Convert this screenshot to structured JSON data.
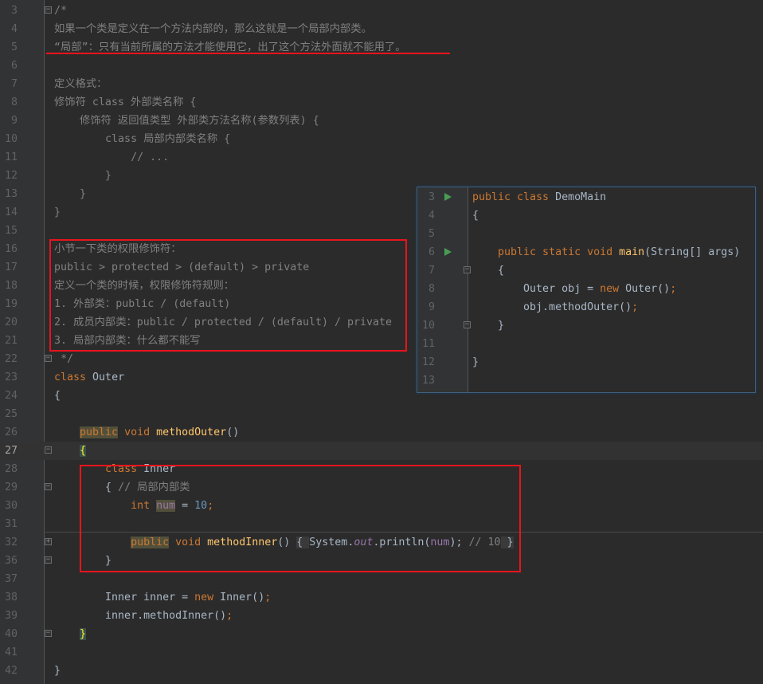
{
  "editor": {
    "lines": [
      {
        "n": "3",
        "fold": "fold-open",
        "tokens": [
          {
            "t": "/*",
            "c": "cm"
          }
        ]
      },
      {
        "n": "4",
        "tokens": [
          {
            "t": "如果一个类是定义在一个方法内部的，那么这就是一个局部内部类。",
            "c": "cm"
          }
        ]
      },
      {
        "n": "5",
        "tokens": [
          {
            "t": "“局部”：只有当前所属的方法才能使用它，出了这个方法外面就不能用了。",
            "c": "cm"
          }
        ]
      },
      {
        "n": "6",
        "tokens": []
      },
      {
        "n": "7",
        "tokens": [
          {
            "t": "定义格式：",
            "c": "cm"
          }
        ]
      },
      {
        "n": "8",
        "tokens": [
          {
            "t": "修饰符 class 外部类名称 {",
            "c": "cm"
          }
        ]
      },
      {
        "n": "9",
        "tokens": [
          {
            "t": "    修饰符 返回值类型 外部类方法名称(参数列表) {",
            "c": "cm"
          }
        ]
      },
      {
        "n": "10",
        "tokens": [
          {
            "t": "        class 局部内部类名称 {",
            "c": "cm"
          }
        ]
      },
      {
        "n": "11",
        "tokens": [
          {
            "t": "            // ...",
            "c": "cm"
          }
        ]
      },
      {
        "n": "12",
        "tokens": [
          {
            "t": "        }",
            "c": "cm"
          }
        ]
      },
      {
        "n": "13",
        "tokens": [
          {
            "t": "    }",
            "c": "cm"
          }
        ]
      },
      {
        "n": "14",
        "tokens": [
          {
            "t": "}",
            "c": "cm"
          }
        ]
      },
      {
        "n": "15",
        "tokens": []
      },
      {
        "n": "16",
        "tokens": [
          {
            "t": "小节一下类的权限修饰符：",
            "c": "cm"
          }
        ]
      },
      {
        "n": "17",
        "tokens": [
          {
            "t": "public > protected > (default) > private",
            "c": "cm"
          }
        ]
      },
      {
        "n": "18",
        "tokens": [
          {
            "t": "定义一个类的时候，权限修饰符规则：",
            "c": "cm"
          }
        ]
      },
      {
        "n": "19",
        "tokens": [
          {
            "t": "1. 外部类：public / (default)",
            "c": "cm"
          }
        ]
      },
      {
        "n": "20",
        "tokens": [
          {
            "t": "2. 成员内部类：public / protected / (default) / private",
            "c": "cm"
          }
        ]
      },
      {
        "n": "21",
        "tokens": [
          {
            "t": "3. 局部内部类：什么都不能写",
            "c": "cm"
          }
        ]
      },
      {
        "n": "22",
        "fold": "fold-close",
        "tokens": [
          {
            "t": " */",
            "c": "cm"
          }
        ]
      },
      {
        "n": "23",
        "tokens": [
          {
            "t": "class ",
            "c": "kw"
          },
          {
            "t": "Outer",
            "c": "id"
          }
        ]
      },
      {
        "n": "24",
        "tokens": [
          {
            "t": "{",
            "c": "id"
          }
        ]
      },
      {
        "n": "25",
        "tokens": []
      },
      {
        "n": "26",
        "tokens": [
          {
            "t": "    ",
            "c": "id"
          },
          {
            "t": "public",
            "c": "kw hl"
          },
          {
            "t": " void ",
            "c": "kw"
          },
          {
            "t": "methodOuter",
            "c": "fn"
          },
          {
            "t": "()",
            "c": "id"
          }
        ]
      },
      {
        "n": "27",
        "current": true,
        "fold": "fold-open",
        "tokens": [
          {
            "t": "    ",
            "c": "id"
          },
          {
            "t": "{",
            "c": "br"
          }
        ]
      },
      {
        "n": "28",
        "tokens": [
          {
            "t": "        ",
            "c": "id"
          },
          {
            "t": "class ",
            "c": "kw"
          },
          {
            "t": "Inner",
            "c": "id"
          }
        ]
      },
      {
        "n": "29",
        "fold": "fold-open",
        "tokens": [
          {
            "t": "        { ",
            "c": "id"
          },
          {
            "t": "// 局部内部类",
            "c": "cm"
          }
        ]
      },
      {
        "n": "30",
        "tokens": [
          {
            "t": "            ",
            "c": "id"
          },
          {
            "t": "int ",
            "c": "kw"
          },
          {
            "t": "num",
            "c": "fld hl"
          },
          {
            "t": " = ",
            "c": "id"
          },
          {
            "t": "10",
            "c": "num"
          },
          {
            "t": ";",
            "c": "kw"
          }
        ]
      },
      {
        "n": "31",
        "tokens": []
      },
      {
        "n": "32",
        "fold": "fold-plus",
        "tokens": [
          {
            "t": "            ",
            "c": "id"
          },
          {
            "t": "public",
            "c": "kw hl"
          },
          {
            "t": " void ",
            "c": "kw"
          },
          {
            "t": "methodInner",
            "c": "fn"
          },
          {
            "t": "() ",
            "c": "id"
          },
          {
            "t": "{ ",
            "c": "id fb"
          },
          {
            "t": "System.",
            "c": "id"
          },
          {
            "t": "out",
            "c": "fld it"
          },
          {
            "t": ".println(",
            "c": "id"
          },
          {
            "t": "num",
            "c": "fld"
          },
          {
            "t": "); ",
            "c": "id"
          },
          {
            "t": "// 10",
            "c": "cm"
          },
          {
            "t": " }",
            "c": "id fb"
          }
        ]
      },
      {
        "n": "36",
        "fold": "fold-close",
        "tokens": [
          {
            "t": "        }",
            "c": "id"
          }
        ]
      },
      {
        "n": "37",
        "tokens": []
      },
      {
        "n": "38",
        "tokens": [
          {
            "t": "        Inner inner = ",
            "c": "id"
          },
          {
            "t": "new ",
            "c": "kw"
          },
          {
            "t": "Inner()",
            "c": "id"
          },
          {
            "t": ";",
            "c": "kw"
          }
        ]
      },
      {
        "n": "39",
        "tokens": [
          {
            "t": "        inner.methodInner()",
            "c": "id"
          },
          {
            "t": ";",
            "c": "kw"
          }
        ]
      },
      {
        "n": "40",
        "fold": "fold-close",
        "tokens": [
          {
            "t": "    ",
            "c": "id"
          },
          {
            "t": "}",
            "c": "br"
          }
        ]
      },
      {
        "n": "41",
        "tokens": []
      },
      {
        "n": "42",
        "tokens": [
          {
            "t": "}",
            "c": "id"
          }
        ]
      }
    ]
  },
  "popup": {
    "lines": [
      {
        "n": "3",
        "run": true,
        "tokens": [
          {
            "t": "public class ",
            "c": "kw"
          },
          {
            "t": "DemoMain",
            "c": "id"
          }
        ]
      },
      {
        "n": "4",
        "tokens": [
          {
            "t": "{",
            "c": "id"
          }
        ]
      },
      {
        "n": "5",
        "tokens": []
      },
      {
        "n": "6",
        "run": true,
        "tokens": [
          {
            "t": "    public static void ",
            "c": "kw"
          },
          {
            "t": "main",
            "c": "fn"
          },
          {
            "t": "(String[] args)",
            "c": "id"
          }
        ]
      },
      {
        "n": "7",
        "fold": "fold-open",
        "tokens": [
          {
            "t": "    {",
            "c": "id"
          }
        ]
      },
      {
        "n": "8",
        "tokens": [
          {
            "t": "        Outer obj = ",
            "c": "id"
          },
          {
            "t": "new ",
            "c": "kw"
          },
          {
            "t": "Outer()",
            "c": "id"
          },
          {
            "t": ";",
            "c": "kw"
          }
        ]
      },
      {
        "n": "9",
        "tokens": [
          {
            "t": "        obj.methodOuter()",
            "c": "id"
          },
          {
            "t": ";",
            "c": "kw"
          }
        ]
      },
      {
        "n": "10",
        "fold": "fold-close",
        "tokens": [
          {
            "t": "    }",
            "c": "id"
          }
        ]
      },
      {
        "n": "11",
        "tokens": []
      },
      {
        "n": "12",
        "tokens": [
          {
            "t": "}",
            "c": "id"
          }
        ]
      },
      {
        "n": "13",
        "tokens": []
      }
    ]
  },
  "colors": {
    "background": "#2b2b2b",
    "keyword": "#cc7832",
    "text": "#a9b7c6",
    "comment": "#808080",
    "method": "#ffc66d",
    "number": "#6897bb",
    "field": "#9876aa",
    "annotation_red": "#e8141c",
    "popup_border": "#3d6185"
  }
}
